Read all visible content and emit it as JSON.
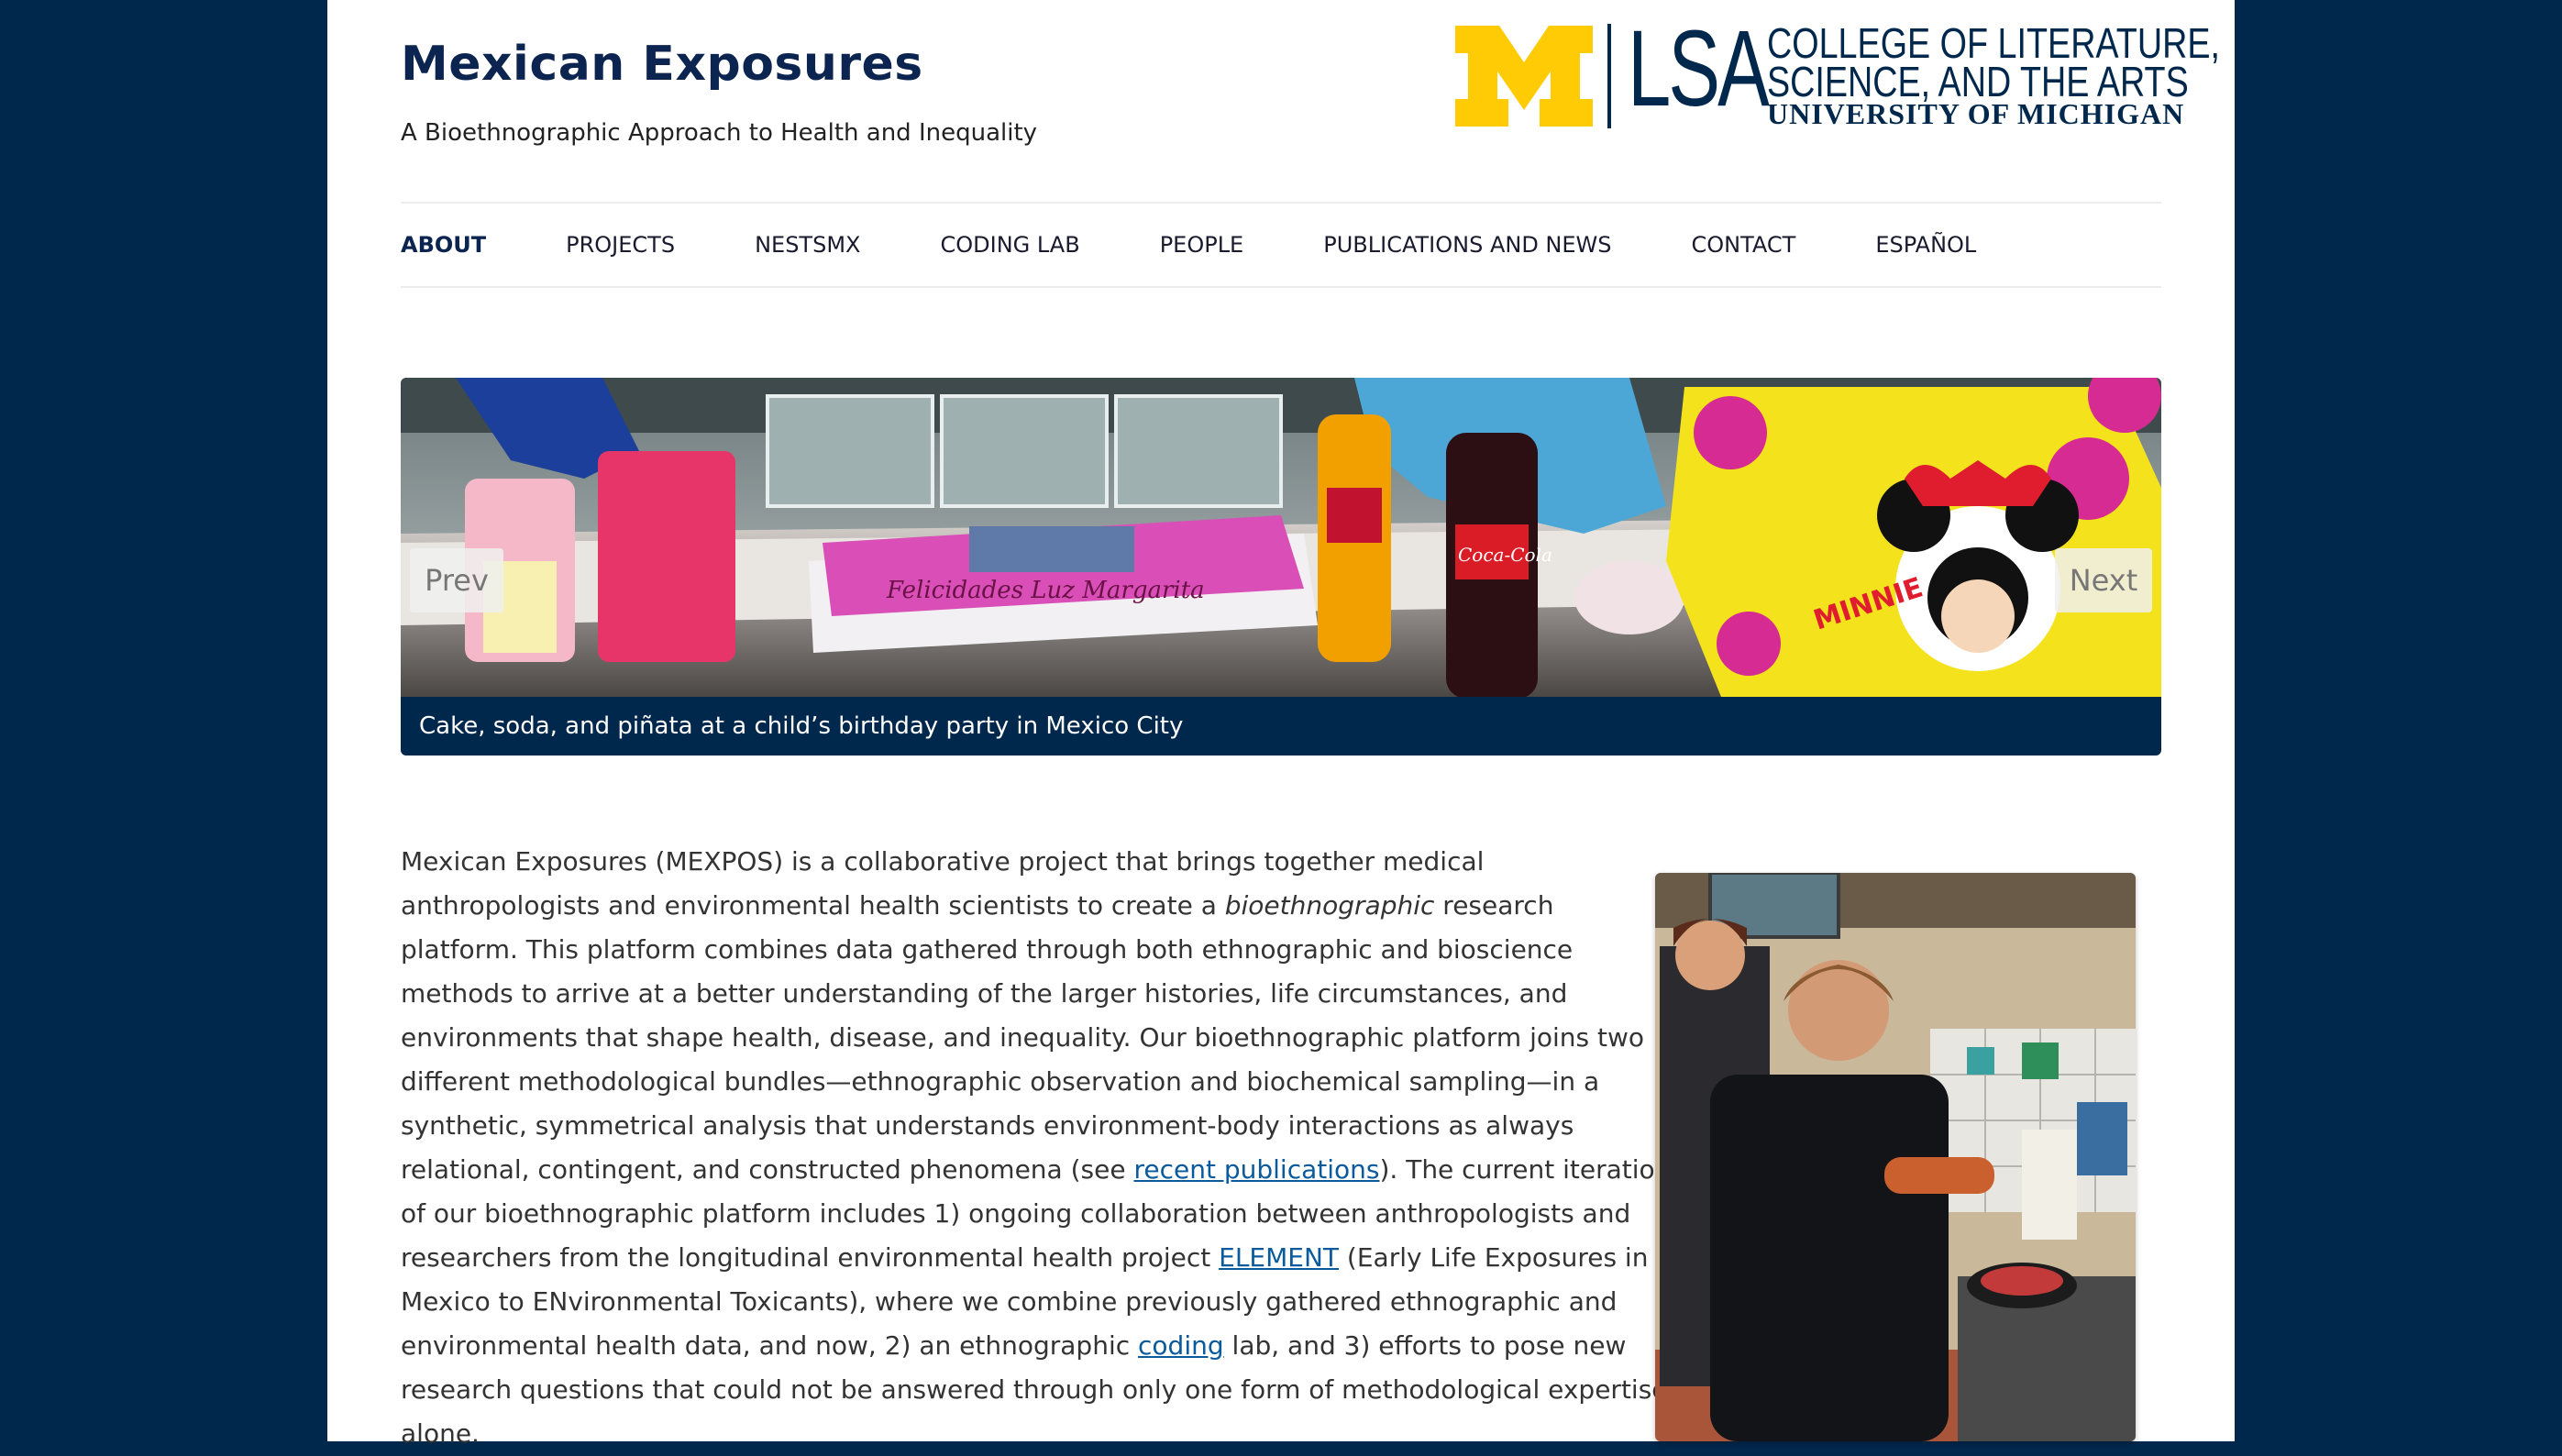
{
  "site": {
    "title": "Mexican Exposures",
    "tagline": "A Bioethnographic Approach to Health and Inequality"
  },
  "logo": {
    "lsa": "LSA",
    "line1": "COLLEGE OF LITERATURE,",
    "line2": "SCIENCE, AND THE ARTS",
    "line3": "UNIVERSITY OF MICHIGAN",
    "colors": {
      "maize": "#ffcb05",
      "blue": "#00274c"
    }
  },
  "nav": {
    "items": [
      {
        "label": "ABOUT",
        "active": true
      },
      {
        "label": "PROJECTS"
      },
      {
        "label": "NESTSMX"
      },
      {
        "label": "CODING LAB"
      },
      {
        "label": "PEOPLE"
      },
      {
        "label": "PUBLICATIONS AND NEWS"
      },
      {
        "label": "CONTACT"
      },
      {
        "label": "ESPAÑOL"
      }
    ]
  },
  "slider": {
    "prev_label": "Prev",
    "next_label": "Next",
    "caption": "Cake, soda, and piñata at a child’s birthday party in Mexico City",
    "cake_text": "Felicidades Luz Margarita",
    "minnie_text": "MINNIE",
    "soda_brand": "Coca-Cola"
  },
  "body": {
    "p1": "Mexican Exposures (MEXPOS) is a collaborative project that brings together medical anthropologists and environmental health scientists to create a ",
    "p1_em": "bioethnographic",
    "p2": " research platform.  This platform combines data gathered through both ethnographic and bioscience methods to arrive at a better understanding of the larger histories, life circumstances, and environments that shape health, disease, and inequality. Our bioethnographic platform joins two different methodological bundles—ethnographic observation and biochemical sampling—in a synthetic, symmetrical analysis that understands environment-body interactions as always relational, contingent, and constructed phenomena (see ",
    "link1": "recent publications",
    "p3": "). The current iteration of our bioethnographic platform includes 1) ongoing collaboration between anthropologists and researchers from the longitudinal environmental health project ",
    "link2": "ELEMENT",
    "p4": " (Early Life Exposures in Mexico to ENvironmental Toxicants), where we combine previously gathered ethnographic and environmental health data, and now, 2) an ethnographic ",
    "link3": "coding",
    "p5": " lab, and 3) efforts to pose new research questions that could not be answered through only one form of methodological expertise alone."
  }
}
